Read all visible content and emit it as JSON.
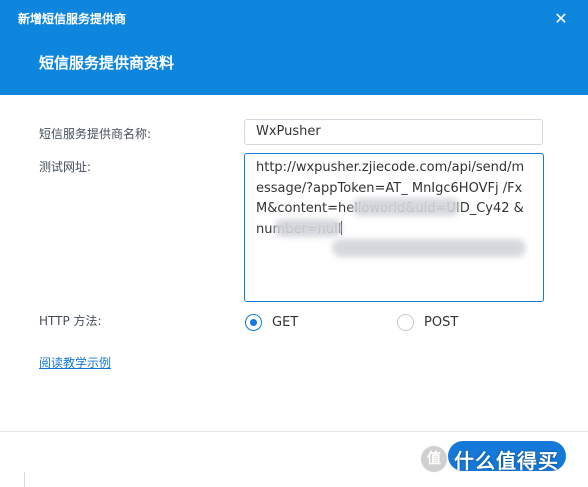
{
  "window": {
    "title": "新增短信服务提供商",
    "close_glyph": "✕",
    "section_title": "短信服务提供商资料"
  },
  "form": {
    "provider_name_label": "短信服务提供商名称:",
    "provider_name_value": "WxPusher",
    "test_url_label": "测试网址:",
    "test_url_value": "http://wxpusher.zjiecode.com/api/send/message/?appToken=AT_ MnIgc6HOVFj /FxM&content=helloworld&uid=UID_Cy42 &number=null",
    "http_method_label": "HTTP 方法:",
    "methods": [
      {
        "label": "GET",
        "selected": true
      },
      {
        "label": "POST",
        "selected": false
      }
    ]
  },
  "help_link": "阅读教学示例",
  "watermark": {
    "badge": "值",
    "text": "什么值得买"
  },
  "colors": {
    "header": "#0f86dd",
    "accent": "#1479d8"
  }
}
